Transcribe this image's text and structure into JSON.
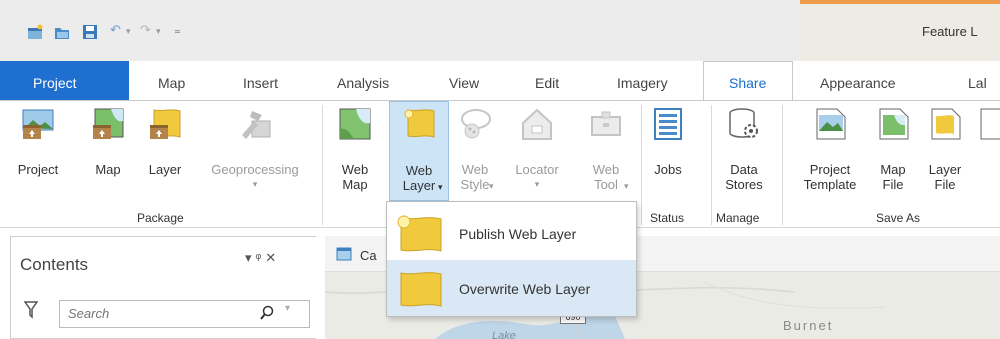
{
  "title_bar": {
    "context_title": "Feature L"
  },
  "tabs": {
    "project": "Project",
    "map": "Map",
    "insert": "Insert",
    "analysis": "Analysis",
    "view": "View",
    "edit": "Edit",
    "imagery": "Imagery",
    "share": "Share",
    "appearance": "Appearance",
    "labeling": "Lal"
  },
  "ribbon": {
    "package": {
      "project": "Project",
      "map": "Map",
      "layer": "Layer",
      "geoprocessing": "Geoprocessing",
      "label": "Package"
    },
    "share_as": {
      "web_map_1": "Web",
      "web_map_2": "Map",
      "web_layer_1": "Web",
      "web_layer_2": "Layer",
      "web_style_1": "Web",
      "web_style_2": "Style",
      "locator": "Locator",
      "web_tool_1": "Web",
      "web_tool_2": "Tool"
    },
    "status": {
      "jobs": "Jobs",
      "label": "Status"
    },
    "manage": {
      "data_stores_1": "Data",
      "data_stores_2": "Stores",
      "label": "Manage"
    },
    "save_as": {
      "project_template_1": "Project",
      "project_template_2": "Template",
      "map_file_1": "Map",
      "map_file_2": "File",
      "layer_file_1": "Layer",
      "layer_file_2": "File",
      "label": "Save As"
    }
  },
  "dropdown": {
    "publish": "Publish Web Layer",
    "overwrite": "Overwrite Web Layer"
  },
  "contents": {
    "title": "Contents",
    "search_placeholder": "Search"
  },
  "map_view": {
    "tab_label": "Ca",
    "label_burnet": "Burnet",
    "label_lake": "Lake",
    "highway_shield": "690"
  },
  "colors": {
    "accent": "#1f6fd1",
    "context_tab": "#ef9b4c",
    "menu_highlight": "#dae8f6",
    "layer_yellow": "#f0c93c"
  }
}
